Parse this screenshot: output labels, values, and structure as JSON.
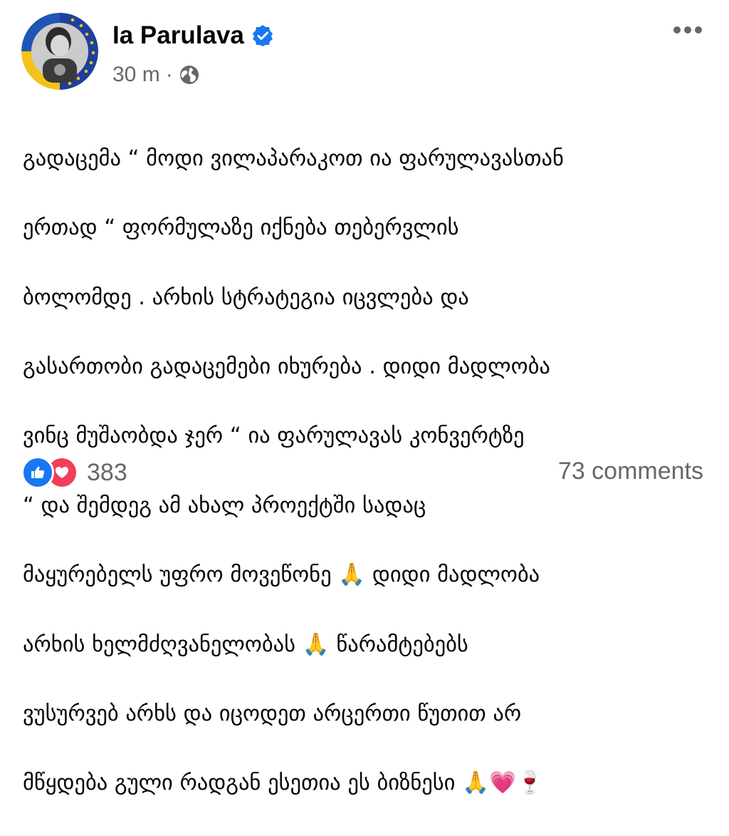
{
  "post": {
    "author": "Ia Parulava",
    "time": "30 m",
    "separator": "·",
    "lines": [
      "გადაცემა “ მოდი ვილაპარაკოთ ია ფარულავასთან",
      "ერთად “ ფორმულაზე იქნება თებერვლის",
      "ბოლომდე . არხის სტრატეგია იცვლება და",
      "გასართობი გადაცემები იხურება . დიდი მადლობა",
      "ვინც მუშაობდა ჯერ “ ია ფარულავას კონვერტზე",
      "“ და შემდეგ ამ ახალ პროექტში სადაც",
      "მაყურებელს უფრო მოვეწონე 🙏  დიდი მადლობა",
      "არხის ხელმძღვანელობას 🙏 წარამტებებს",
      "ვუსურვებ არხს და იცოდეთ არცერთი წუთით არ",
      "მწყდება გული რადგან ესეთია ეს ბიზნესი 🙏💗🍷"
    ]
  },
  "reactions": {
    "count": "383",
    "comments": "73 comments",
    "icons": [
      "like-icon",
      "love-icon"
    ]
  },
  "colors": {
    "brand_blue": "#1877f2",
    "love_red": "#f33e58",
    "meta_gray": "#65676b"
  }
}
